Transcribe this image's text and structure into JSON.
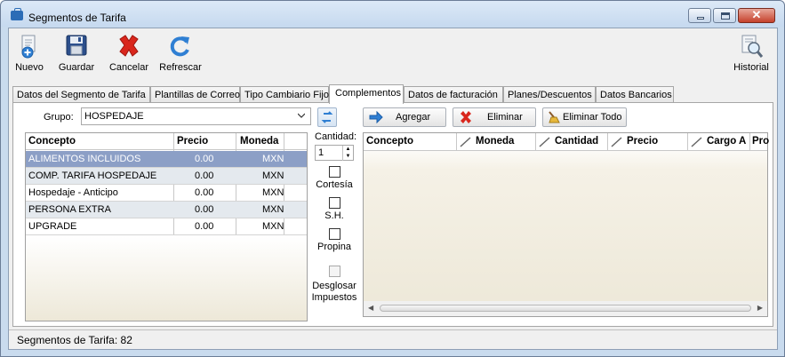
{
  "window": {
    "title": "Segmentos de Tarifa"
  },
  "toolbar": {
    "nuevo": "Nuevo",
    "guardar": "Guardar",
    "cancelar": "Cancelar",
    "refrescar": "Refrescar",
    "historial": "Historial"
  },
  "tabs": [
    {
      "label": "Datos del Segmento de Tarifa"
    },
    {
      "label": "Plantillas de Correo"
    },
    {
      "label": "Tipo Cambiario Fijo"
    },
    {
      "label": "Complementos",
      "active": true
    },
    {
      "label": "Datos de facturación"
    },
    {
      "label": "Planes/Descuentos"
    },
    {
      "label": "Datos Bancarios"
    }
  ],
  "complementos": {
    "grupo_label": "Grupo:",
    "grupo_value": "HOSPEDAJE",
    "cantidad_label": "Cantidad:",
    "cantidad_value": "1",
    "checks": {
      "cortesia": "Cortesía",
      "sh": "S.H.",
      "propina": "Propina",
      "desglosar_1": "Desglosar",
      "desglosar_2": "Impuestos"
    },
    "buttons": {
      "agregar": "Agregar",
      "eliminar": "Eliminar",
      "eliminar_todo": "Eliminar Todo"
    },
    "left_grid": {
      "headers": [
        "Concepto",
        "Precio",
        "Moneda"
      ],
      "rows": [
        [
          "ALIMENTOS INCLUIDOS",
          "0.00",
          "MXN"
        ],
        [
          "COMP. TARIFA HOSPEDAJE",
          "0.00",
          "MXN"
        ],
        [
          "Hospedaje - Anticipo",
          "0.00",
          "MXN"
        ],
        [
          "PERSONA EXTRA",
          "0.00",
          "MXN"
        ],
        [
          "UPGRADE",
          "0.00",
          "MXN"
        ]
      ]
    },
    "right_grid": {
      "headers": [
        "Concepto",
        "Moneda",
        "Cantidad",
        "Precio",
        "Cargo A",
        "Pro"
      ]
    }
  },
  "status": {
    "text": "Segmentos de Tarifa: 82"
  },
  "colors": {
    "selected_row": "#8c9fc6",
    "window_frame": "#c9dbee"
  }
}
